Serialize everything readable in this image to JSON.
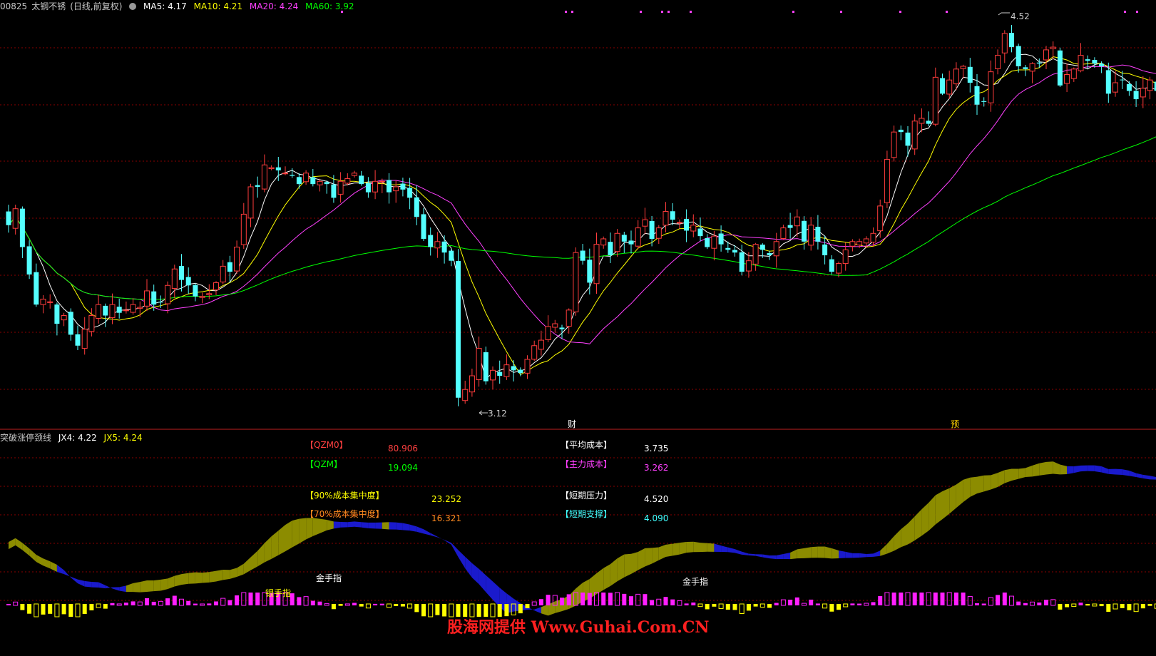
{
  "header": {
    "code": "00825",
    "name": "太钢不锈",
    "period": "(日线,前复权)",
    "ma5": "MA5: 4.17",
    "ma10": "MA10: 4.21",
    "ma20": "MA20: 4.24",
    "ma60": "MA60: 3.92"
  },
  "sub_header": {
    "indicator_name": "突破涨停颈线",
    "jx4": "JX4: 4.22",
    "jx5": "JX5: 4.24"
  },
  "info_panel": {
    "qzm0_label": "【QZM0】",
    "qzm0_value": "80.906",
    "qzm_label": "【QZM】",
    "qzm_value": "19.094",
    "c90_label": "【90%成本集中度】",
    "c90_value": "23.252",
    "c70_label": "【70%成本集中度】",
    "c70_value": "16.321",
    "avg_label": "【平均成本】",
    "avg_value": "3.735",
    "main_label": "【主力成本】",
    "main_value": "3.262",
    "pressure_label": "【短期压力】",
    "pressure_value": "4.520",
    "support_label": "【短期支撑】",
    "support_value": "4.090"
  },
  "annotations": {
    "high_label": "4.52",
    "low_label": "3.12",
    "fin_marker": "财",
    "adv_marker": "预",
    "gold_finger": "金手指",
    "silver_finger": "银手指"
  },
  "watermark": "股海网提供 Www.Guhai.Com.CN",
  "colors": {
    "up": "#ff3c3c",
    "down": "#54ffff",
    "ma5": "#ffffff",
    "ma10": "#ffff00",
    "ma20": "#ff40ff",
    "ma60": "#00ff00",
    "band_up": "#8c8c00",
    "band_down": "#1a1acc",
    "bar_yellow": "#ffff00",
    "bar_magenta": "#ff20ff",
    "grid": "#8a0000"
  },
  "chart_data": {
    "type": "candlestick",
    "price_range": [
      3.06,
      4.57
    ],
    "closes": [
      3.8,
      3.86,
      3.72,
      3.62,
      3.51,
      3.53,
      3.52,
      3.44,
      3.47,
      3.4,
      3.36,
      3.42,
      3.47,
      3.51,
      3.47,
      3.51,
      3.48,
      3.49,
      3.51,
      3.5,
      3.56,
      3.51,
      3.52,
      3.58,
      3.64,
      3.6,
      3.58,
      3.54,
      3.54,
      3.55,
      3.59,
      3.65,
      3.63,
      3.72,
      3.84,
      3.94,
      3.94,
      4.02,
      4.01,
      4.0,
      3.99,
      3.98,
      3.95,
      3.99,
      3.95,
      3.96,
      3.95,
      3.9,
      3.96,
      3.97,
      3.99,
      3.95,
      3.92,
      3.96,
      3.96,
      3.92,
      3.94,
      3.93,
      3.9,
      3.83,
      3.75,
      3.72,
      3.74,
      3.7,
      3.67,
      3.17,
      3.2,
      3.25,
      3.35,
      3.23,
      3.27,
      3.25,
      3.29,
      3.27,
      3.26,
      3.31,
      3.36,
      3.38,
      3.43,
      3.44,
      3.42,
      3.49,
      3.7,
      3.67,
      3.59,
      3.73,
      3.75,
      3.69,
      3.77,
      3.74,
      3.73,
      3.79,
      3.82,
      3.75,
      3.79,
      3.85,
      3.82,
      3.81,
      3.78,
      3.8,
      3.76,
      3.72,
      3.76,
      3.73,
      3.71,
      3.7,
      3.63,
      3.67,
      3.73,
      3.71,
      3.69,
      3.74,
      3.79,
      3.79,
      3.83,
      3.74,
      3.8,
      3.74,
      3.69,
      3.63,
      3.66,
      3.71,
      3.74,
      3.74,
      3.75,
      3.77,
      3.87,
      4.04,
      4.14,
      4.14,
      4.09,
      4.18,
      4.19,
      4.17,
      4.34,
      4.28,
      4.33,
      4.37,
      4.38,
      4.32,
      4.24,
      4.25,
      4.36,
      4.42,
      4.5,
      4.45,
      4.38,
      4.37,
      4.39,
      4.39,
      4.44,
      4.45,
      4.31,
      4.35,
      4.37,
      4.42,
      4.4,
      4.39,
      4.38,
      4.28,
      4.32,
      4.33,
      4.29,
      4.26,
      4.3,
      4.33,
      4.29,
      4.3,
      4.31
    ],
    "ma_lines": [
      "MA5",
      "MA10",
      "MA20",
      "MA60"
    ],
    "high_label": 4.52,
    "low_label": 3.12,
    "sub_indicator": "突破涨停颈线",
    "jx4": 4.22,
    "jx5": 4.24
  }
}
